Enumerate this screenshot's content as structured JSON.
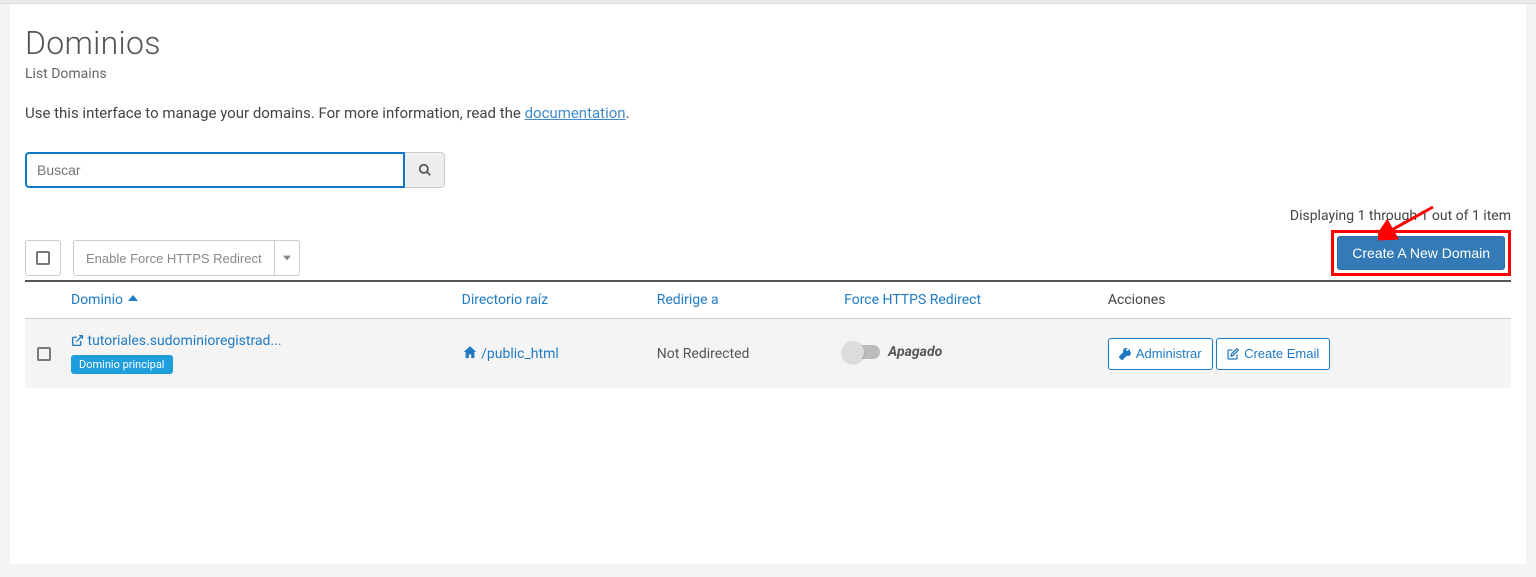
{
  "page": {
    "title": "Dominios",
    "subtitle": "List Domains",
    "description_pre": "Use this interface to manage your domains. For more information, read the ",
    "description_link": "documentation",
    "description_post": "."
  },
  "search": {
    "placeholder": "Buscar"
  },
  "toolbar": {
    "enable_https_label": "Enable Force HTTPS Redirect",
    "display_count": "Displaying 1 through 1 out of 1 item",
    "create_btn": "Create A New Domain"
  },
  "table": {
    "headers": {
      "domain": "Dominio",
      "root": "Directorio raíz",
      "redirect": "Redirige a",
      "force_https": "Force HTTPS Redirect",
      "actions": "Acciones"
    },
    "rows": [
      {
        "domain": "tutoriales.sudominioregistrad...",
        "badge": "Dominio principal",
        "root": "/public_html",
        "redirect": "Not Redirected",
        "toggle": "Apagado",
        "manage": "Administrar",
        "email": "Create Email"
      }
    ]
  }
}
